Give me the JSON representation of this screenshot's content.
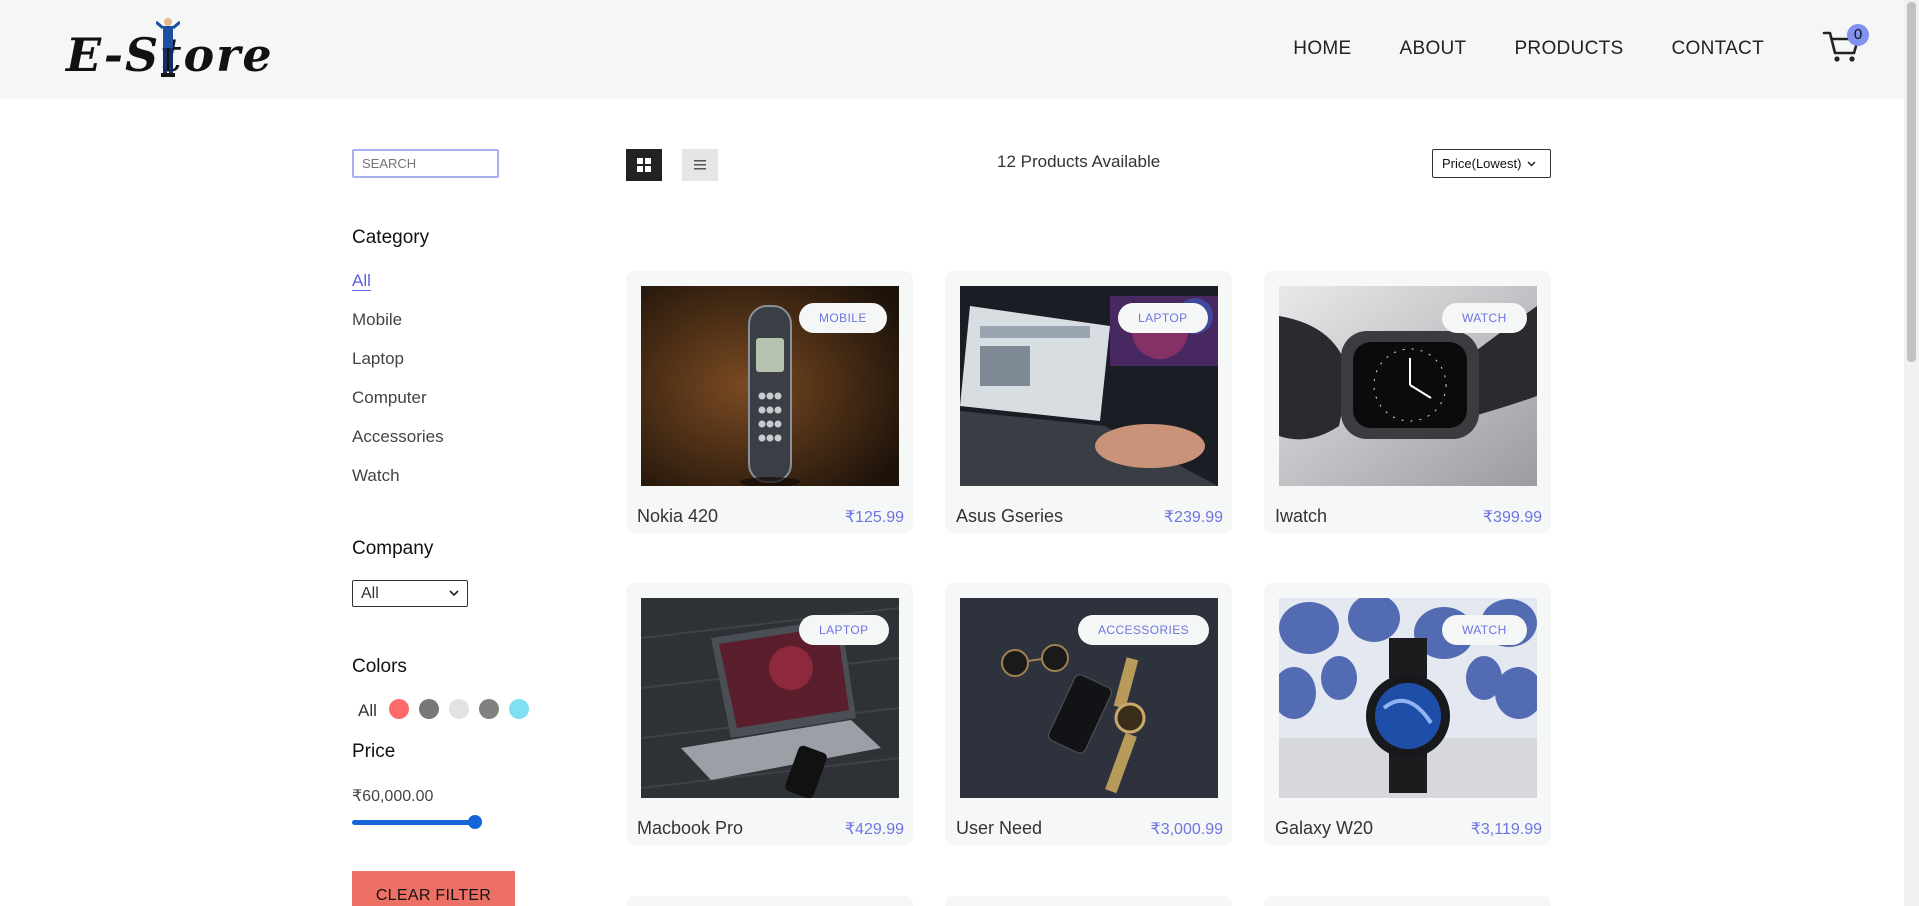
{
  "header": {
    "logo_text": "E-Store",
    "nav": [
      "HOME",
      "ABOUT",
      "PRODUCTS",
      "CONTACT"
    ],
    "cart_count": "0"
  },
  "sidebar": {
    "search_placeholder": "SEARCH",
    "category_title": "Category",
    "categories": [
      "All",
      "Mobile",
      "Laptop",
      "Computer",
      "Accessories",
      "Watch"
    ],
    "company_title": "Company",
    "company_selected": "All",
    "colors_title": "Colors",
    "colors_all": "All",
    "colors": [
      "#ff6b6b",
      "#777777",
      "#e2e2e2",
      "#808080",
      "#7fe0f5"
    ],
    "price_title": "Price",
    "price_value": "₹60,000.00",
    "price_slider_fraction": 0.95,
    "clear_filter": "CLEAR FILTER"
  },
  "toolbar": {
    "count_text": "12 Products Available",
    "sort_selected": "Price(Lowest)"
  },
  "products": [
    {
      "name": "Nokia 420",
      "price": "₹125.99",
      "category": "MOBILE",
      "image": "phone"
    },
    {
      "name": "Asus Gseries",
      "price": "₹239.99",
      "category": "LAPTOP",
      "image": "laptop-typing"
    },
    {
      "name": "Iwatch",
      "price": "₹399.99",
      "category": "WATCH",
      "image": "smartwatch"
    },
    {
      "name": "Macbook Pro",
      "price": "₹429.99",
      "category": "LAPTOP",
      "image": "macbook"
    },
    {
      "name": "User Need",
      "price": "₹3,000.99",
      "category": "ACCESSORIES",
      "image": "accessories"
    },
    {
      "name": "Galaxy W20",
      "price": "₹3,119.99",
      "category": "WATCH",
      "image": "galaxy-watch"
    }
  ],
  "colors": {
    "accent": "#6e75e0",
    "clear_button": "#ec7063",
    "slider": "#1565d8",
    "header_bg": "#f5f7f7"
  }
}
